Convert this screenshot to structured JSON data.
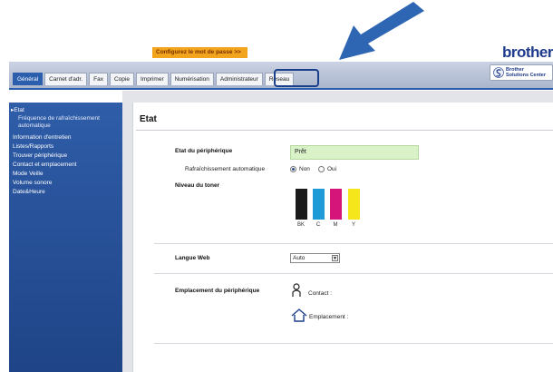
{
  "header": {
    "password_link": "Configurez le mot de passe >>",
    "brand": "brother"
  },
  "tabs": [
    {
      "label": "Général",
      "active": true
    },
    {
      "label": "Carnet d'adr."
    },
    {
      "label": "Fax"
    },
    {
      "label": "Copie"
    },
    {
      "label": "Imprimer"
    },
    {
      "label": "Numérisation"
    },
    {
      "label": "Administrateur"
    },
    {
      "label": "Réseau",
      "highlighted": true
    }
  ],
  "solutions": {
    "line1": "Brother",
    "line2": "Solutions Center"
  },
  "sidebar": {
    "items": [
      {
        "label": "Etat",
        "selected": true
      },
      {
        "label": "Information d'entretien"
      },
      {
        "label": "Listes/Rapports"
      },
      {
        "label": "Trouver périphérique"
      },
      {
        "label": "Contact et emplacement"
      },
      {
        "label": "Mode Veille"
      },
      {
        "label": "Volume sonore"
      },
      {
        "label": "Date&Heure"
      }
    ],
    "subitem": "Fréquence de rafraîchissement automatique"
  },
  "main": {
    "title": "Etat",
    "device_status_label": "Etat du périphérique",
    "device_status_value": "Prêt",
    "auto_refresh_label": "Rafraîchissement automatique",
    "auto_refresh_options": [
      "Non",
      "Oui"
    ],
    "auto_refresh_selected": "Non",
    "toner_label": "Niveau du toner",
    "toner": [
      {
        "name": "BK",
        "color": "#1a1a1a",
        "level": 1.0
      },
      {
        "name": "C",
        "color": "#1e9ad6",
        "level": 1.0
      },
      {
        "name": "M",
        "color": "#d6157a",
        "level": 1.0
      },
      {
        "name": "Y",
        "color": "#f5e51b",
        "level": 1.0
      }
    ],
    "web_language_label": "Langue Web",
    "web_language_value": "Auto",
    "location_label": "Emplacement du périphérique",
    "contact_label": "Contact :",
    "location_field_label": "Emplacement :"
  },
  "colors": {
    "accent": "#2b5fae",
    "callout": "#2f66b3",
    "password_bg": "#f2a51c"
  }
}
